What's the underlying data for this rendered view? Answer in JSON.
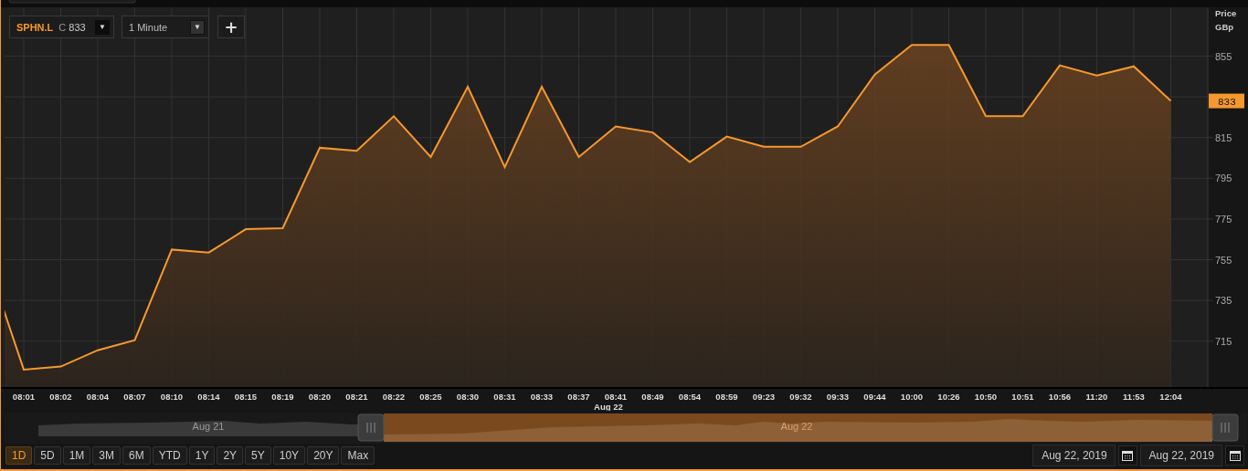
{
  "symbol_selector": {
    "close_label": "C",
    "close_value": "833",
    "arrow": "▼"
  },
  "interval_selector": {
    "value": "1 Minute",
    "arrow": "▼"
  },
  "add_button": "+",
  "chart": {
    "axis_title": "Price",
    "currency": "GBp",
    "last_price": "833",
    "date_label": "Aug 22",
    "chart_data": {
      "type": "area",
      "grid": true,
      "categories": [
        null,
        "08:01",
        "08:02",
        "08:04",
        "08:07",
        "08:10",
        "08:14",
        "08:15",
        "08:19",
        "08:20",
        "08:21",
        "08:22",
        "08:25",
        "08:30",
        "08:31",
        "08:33",
        "08:37",
        "08:41",
        "08:49",
        "08:54",
        "08:59",
        "09:23",
        "09:32",
        "09:33",
        "09:44",
        "10:00",
        "10:26",
        "10:50",
        "10:51",
        "10:56",
        "11:20",
        "11:53",
        "12:04"
      ],
      "series": [
        {
          "name": "SPHN.L",
          "color": "#f7982e",
          "values": [
            755,
            701,
            702.5,
            710.5,
            715.5,
            760,
            758.5,
            770,
            770.5,
            810,
            808.5,
            825.5,
            805.5,
            840,
            800.5,
            840,
            805.5,
            820.5,
            817.5,
            803,
            815.5,
            810.5,
            810.5,
            820.5,
            846,
            860.5,
            860.5,
            825.5,
            825.5,
            850.5,
            845.5,
            850,
            833
          ]
        }
      ],
      "ylim": [
        692,
        879
      ],
      "yticks": [
        715,
        735,
        755,
        775,
        795,
        815,
        855
      ]
    }
  },
  "navigator": {
    "labels": [
      "Aug 21",
      "Aug 22"
    ]
  },
  "ranges": [
    {
      "label": "1D",
      "selected": true
    },
    {
      "label": "5D",
      "selected": false
    },
    {
      "label": "1M",
      "selected": false
    },
    {
      "label": "3M",
      "selected": false
    },
    {
      "label": "6M",
      "selected": false
    },
    {
      "label": "YTD",
      "selected": false
    },
    {
      "label": "1Y",
      "selected": false
    },
    {
      "label": "2Y",
      "selected": false
    },
    {
      "label": "5Y",
      "selected": false
    },
    {
      "label": "10Y",
      "selected": false
    },
    {
      "label": "20Y",
      "selected": false
    },
    {
      "label": "Max",
      "selected": false
    }
  ],
  "date_from": "Aug 22, 2019",
  "date_to": "Aug 22, 2019"
}
